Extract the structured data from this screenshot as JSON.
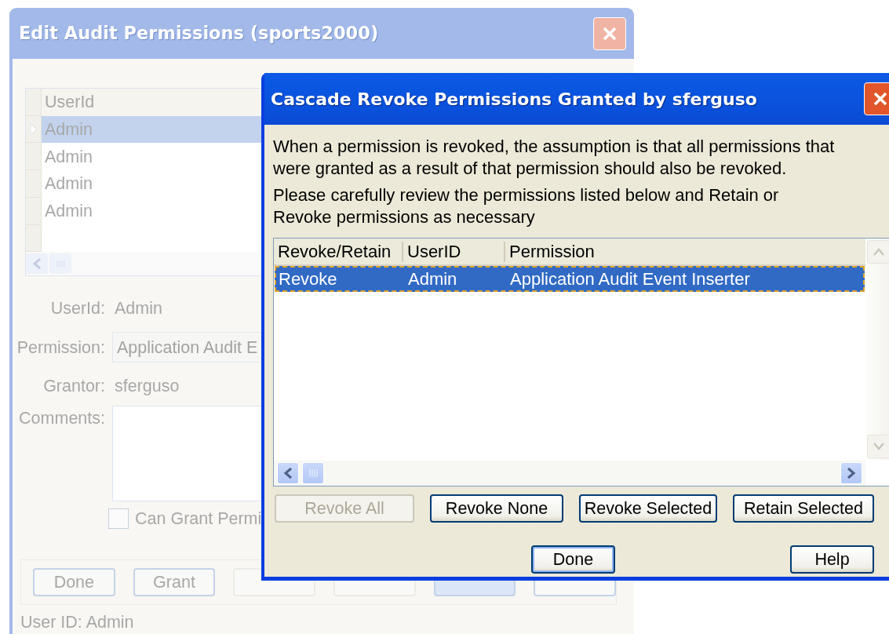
{
  "back_window": {
    "title": "Edit Audit Permissions (sports2000)",
    "grid": {
      "columns": [
        "UserId"
      ],
      "rows": [
        {
          "cells": [
            "Admin"
          ],
          "selected": true
        },
        {
          "cells": [
            "Admin"
          ],
          "selected": false
        },
        {
          "cells": [
            "Admin"
          ],
          "selected": false
        },
        {
          "cells": [
            "Admin"
          ],
          "selected": false
        }
      ]
    },
    "form": {
      "userid_label": "UserId:",
      "userid_value": "Admin",
      "permission_label": "Permission:",
      "permission_value": "Application Audit E",
      "grantor_label": "Grantor:",
      "grantor_value": "sferguso",
      "comments_label": "Comments:",
      "can_grant": {
        "label": "Can Grant Permi",
        "checked": false
      }
    },
    "buttons": [
      {
        "label": "Done",
        "disabled": false
      },
      {
        "label": "Grant",
        "disabled": false
      },
      {
        "disabled": true
      },
      {
        "disabled": true
      },
      {
        "disabled": false
      },
      {
        "disabled": false
      }
    ],
    "status_bar": "User ID: Admin"
  },
  "dialog": {
    "title": "Cascade Revoke Permissions Granted by sferguso",
    "paragraphs": [
      "When a permission is revoked, the assumption is that all permissions that were granted as a result of that permission should also be revoked.",
      "Please carefully review the permissions listed below and Retain or Revoke permissions as necessary"
    ],
    "list": {
      "columns": [
        "Revoke/Retain",
        "UserID",
        "Permission"
      ],
      "rows": [
        {
          "cells": [
            "Revoke",
            "Admin",
            "Application Audit Event Inserter"
          ],
          "selected": true
        }
      ]
    },
    "action_buttons": [
      {
        "label": "Revoke All",
        "disabled": true
      },
      {
        "label": "Revoke None",
        "disabled": false
      },
      {
        "label": "Revoke Selected",
        "disabled": false
      },
      {
        "label": "Retain Selected",
        "disabled": false
      }
    ],
    "footer_buttons": [
      {
        "label": "Done",
        "default": true
      },
      {
        "label": "Help",
        "default": false
      }
    ]
  }
}
